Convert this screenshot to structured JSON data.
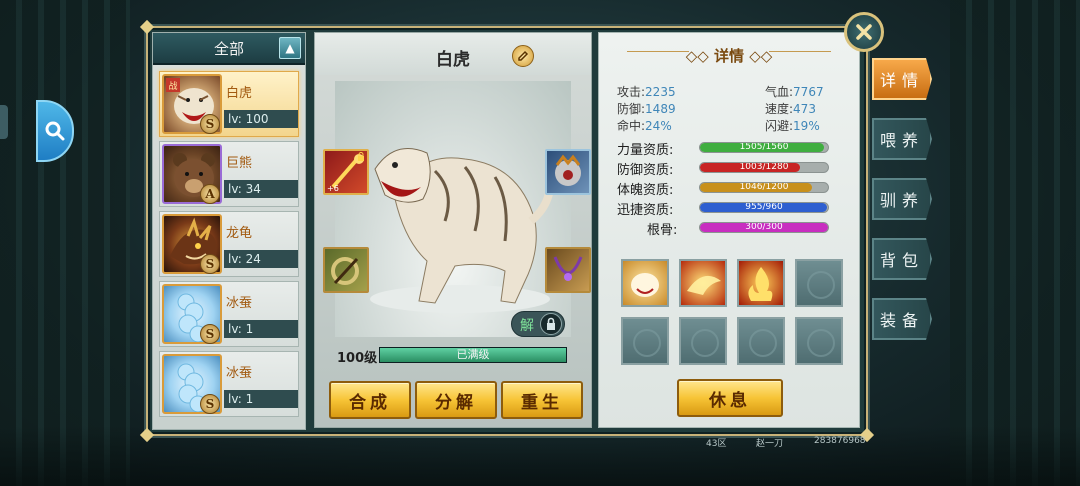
{
  "list": {
    "header": "全部",
    "pets": [
      {
        "name": "白虎",
        "rank": "S",
        "level": "lv: 100",
        "war_tag": "战",
        "selected": true
      },
      {
        "name": "巨熊",
        "rank": "A",
        "level": "lv: 34"
      },
      {
        "name": "龙龟",
        "rank": "S",
        "level": "lv: 24"
      },
      {
        "name": "冰蚕",
        "rank": "S",
        "level": "lv: 1"
      },
      {
        "name": "冰蚕",
        "rank": "S",
        "level": "lv: 1"
      }
    ]
  },
  "center": {
    "pet_name": "白虎",
    "equip_bonus": "+6",
    "lock_label": "解",
    "level_label": "100级",
    "level_status": "已满级",
    "level_progress": 1.0,
    "buttons": {
      "synthesize": "合成",
      "decompose": "分解",
      "rebirth": "重生"
    }
  },
  "detail": {
    "title": "详情",
    "stats": {
      "attack": {
        "label": "攻击:",
        "value": "2235"
      },
      "hp": {
        "label": "气血:",
        "value": "7767"
      },
      "defense": {
        "label": "防御:",
        "value": "1489"
      },
      "speed": {
        "label": "速度:",
        "value": "473"
      },
      "hit": {
        "label": "命中:",
        "value": "24%"
      },
      "dodge": {
        "label": "闪避:",
        "value": "19%"
      }
    },
    "aptitudes": [
      {
        "label": "力量资质:",
        "text": "1505/1560",
        "fraction": 0.965,
        "color": "#3fae3f"
      },
      {
        "label": "防御资质:",
        "text": "1003/1280",
        "fraction": 0.784,
        "color": "#c82424"
      },
      {
        "label": "体魄资质:",
        "text": "1046/1200",
        "fraction": 0.872,
        "color": "#c8901c"
      },
      {
        "label": "迅捷资质:",
        "text": "955/960",
        "fraction": 0.995,
        "color": "#2e5fd0"
      },
      {
        "label": "根骨:",
        "text": "300/300",
        "fraction": 1.0,
        "color": "#c82ec0"
      }
    ],
    "rest_button": "休息"
  },
  "tabs": [
    "详情",
    "喂养",
    "驯养",
    "背包",
    "装备"
  ],
  "footer": {
    "server": "43区",
    "player": "赵一刀",
    "id": "283876968"
  },
  "colors": {
    "accent_gold": "#f7c436",
    "frame_gold": "#c8b278",
    "tab_active": "#e58a2c"
  }
}
